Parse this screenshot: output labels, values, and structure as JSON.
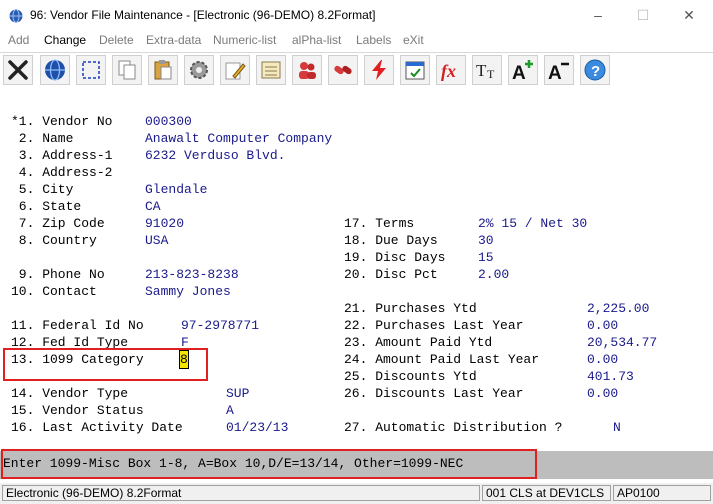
{
  "window": {
    "title": "96: Vendor File Maintenance - [Electronic (96-DEMO) 8.2Format]",
    "minimize": "–",
    "maximize": "☐",
    "close": "✕"
  },
  "menu": [
    {
      "label": "Add"
    },
    {
      "label": "Change"
    },
    {
      "label": "Delete"
    },
    {
      "label": "Extra-data"
    },
    {
      "label": "Numeric-list"
    },
    {
      "label": "alPha-list"
    },
    {
      "label": "Labels"
    },
    {
      "label": "eXit"
    }
  ],
  "toolbar": [
    "close-icon",
    "globe-icon",
    "select-icon",
    "copy-icon",
    "paste-icon",
    "settings-icon",
    "edit-icon",
    "notes-icon",
    "users-icon",
    "link-icon",
    "lightning-icon",
    "calendar-icon",
    "formula-icon",
    "font-icon",
    "font-larger-icon",
    "font-smaller-icon",
    "help-icon"
  ],
  "fields_left": [
    {
      "label": "*1. Vendor No",
      "value": "000300"
    },
    {
      "label": " 2. Name",
      "value": "Anawalt Computer Company"
    },
    {
      "label": " 3. Address-1",
      "value": "6232 Verduso Blvd."
    },
    {
      "label": " 4. Address-2",
      "value": ""
    },
    {
      "label": " 5. City",
      "value": "Glendale"
    },
    {
      "label": " 6. State",
      "value": "CA"
    },
    {
      "label": " 7. Zip Code",
      "value": "91020"
    },
    {
      "label": " 8. Country",
      "value": "USA"
    },
    {
      "label": " 9. Phone No",
      "value": "213-823-8238"
    },
    {
      "label": "10. Contact",
      "value": "Sammy Jones"
    },
    {
      "label": "11. Federal Id No",
      "value": "97-2978771"
    },
    {
      "label": "12. Fed Id Type",
      "value": "F"
    },
    {
      "label": "13. 1099 Category",
      "value": "8"
    },
    {
      "label": "14. Vendor Type",
      "value": "SUP"
    },
    {
      "label": "15. Vendor Status",
      "value": "A"
    },
    {
      "label": "16. Last Activity Date",
      "value": "01/23/13"
    }
  ],
  "fields_right": [
    {
      "label": "17. Terms",
      "value": "2% 15 / Net 30"
    },
    {
      "label": "18. Due Days",
      "value": "30"
    },
    {
      "label": "19. Disc Days",
      "value": "15"
    },
    {
      "label": "20. Disc Pct",
      "value": "2.00"
    },
    {
      "label": "21. Purchases Ytd",
      "value": "2,225.00"
    },
    {
      "label": "22. Purchases Last Year",
      "value": "0.00"
    },
    {
      "label": "23. Amount Paid Ytd",
      "value": "20,534.77"
    },
    {
      "label": "24. Amount Paid Last Year",
      "value": "0.00"
    },
    {
      "label": "25. Discounts Ytd",
      "value": "401.73"
    },
    {
      "label": "26. Discounts Last Year",
      "value": "0.00"
    },
    {
      "label": "27. Automatic Distribution ?",
      "value": "N"
    }
  ],
  "prompt": "Enter 1099-Misc Box 1-8, A=Box 10,D/E=13/14, Other=1099-NEC",
  "status": {
    "company": "Electronic (96-DEMO) 8.2Format",
    "session": "001 CLS at DEV1CLS",
    "program": "AP0100"
  }
}
